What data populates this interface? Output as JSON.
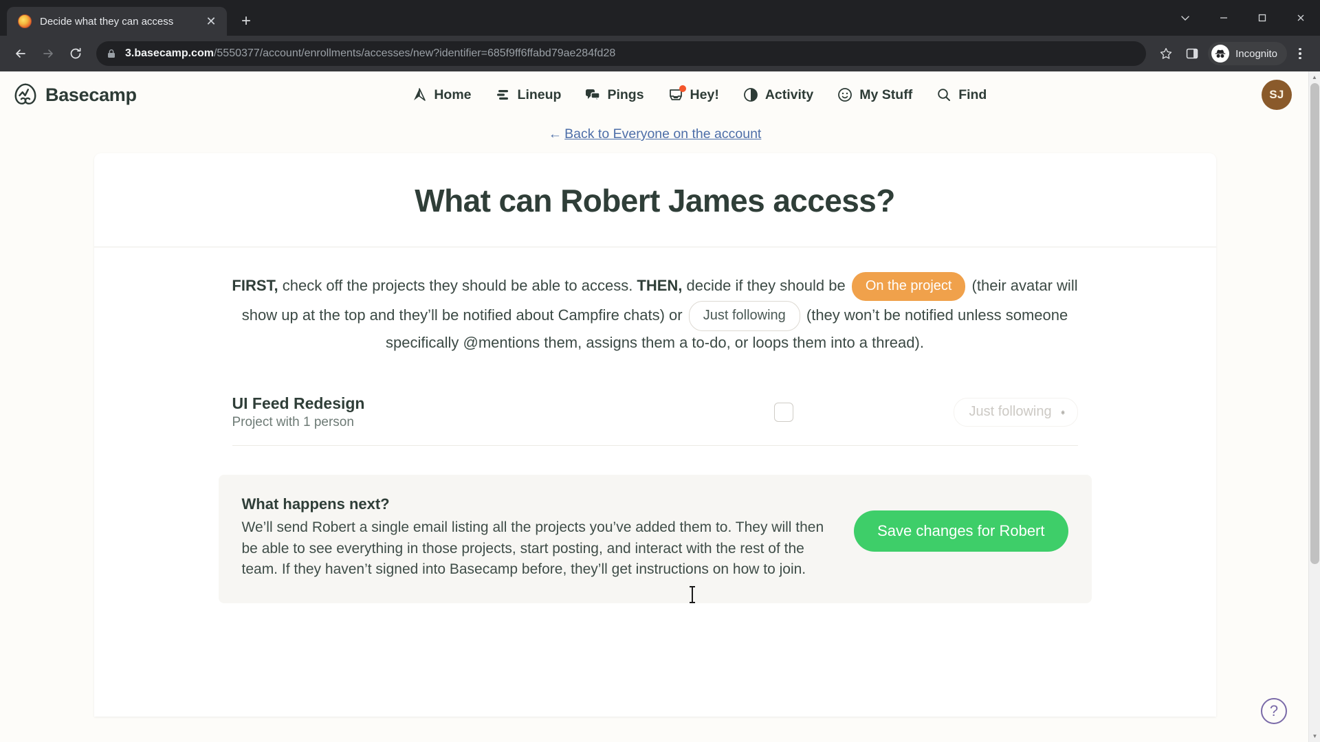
{
  "browser": {
    "tab": {
      "title": "Decide what they can access",
      "favicon": "basecamp-favicon",
      "close_label": "✕"
    },
    "new_tab_label": "+",
    "window": {
      "minimize_label": "─",
      "maximize_label": "☐",
      "close_label": "✕",
      "chevron_label": "⌄"
    },
    "nav": {
      "back_label": "←",
      "forward_label": "→",
      "reload_label": "↻"
    },
    "omnibox": {
      "url_domain": "3.basecamp.com",
      "url_path": "/5550377/account/enrollments/accesses/new?identifier=685f9ff6ffabd79ae284fd28",
      "lock_icon": "lock-icon"
    },
    "toolbar": {
      "bookmark_label": "☆",
      "sidepanel_label": "side-panel-icon",
      "incognito_label": "Incognito",
      "menu_label": "three-dot-menu"
    }
  },
  "app": {
    "logo_text": "Basecamp",
    "nav_items": [
      {
        "label": "Home",
        "icon": "home-icon"
      },
      {
        "label": "Lineup",
        "icon": "lineup-icon"
      },
      {
        "label": "Pings",
        "icon": "pings-icon"
      },
      {
        "label": "Hey!",
        "icon": "hey-inbox-icon",
        "badge": true
      },
      {
        "label": "Activity",
        "icon": "activity-icon"
      },
      {
        "label": "My Stuff",
        "icon": "smiley-icon"
      },
      {
        "label": "Find",
        "icon": "search-icon"
      }
    ],
    "avatar_initials": "SJ",
    "avatar_color": "#8a5a2b"
  },
  "back_link": {
    "arrow": "←",
    "text": "Back to Everyone on the account"
  },
  "page": {
    "title": "What can Robert James access?",
    "intro": {
      "first_bold": "FIRST,",
      "part1": " check off the projects they should be able to access. ",
      "then_bold": "THEN,",
      "part2": " decide if they should be ",
      "pill_on_project": "On the project",
      "part3": " (their avatar will show up at the top and they’ll be notified about Campfire chats) or ",
      "pill_just_following": "Just following",
      "part4": " (they won’t be notified unless someone specifically @mentions them, assigns them a to-do, or loops them into a thread)."
    },
    "projects": [
      {
        "name": "UI Feed Redesign",
        "subtitle": "Project with 1 person",
        "checked": false,
        "access_level": "Just following"
      }
    ],
    "next_panel": {
      "title": "What happens next?",
      "body": "We’ll send Robert a single email listing all the projects you’ve added them to. They will then be able to see everything in those projects, start posting, and interact with the rest of the team. If they haven’t signed into Basecamp before, they’ll get instructions on how to join.",
      "save_label": "Save changes for Robert",
      "save_color": "#3ece69"
    },
    "help_label": "?"
  },
  "scrollbar": {
    "up_arrow": "▲",
    "down_arrow": "▼"
  }
}
